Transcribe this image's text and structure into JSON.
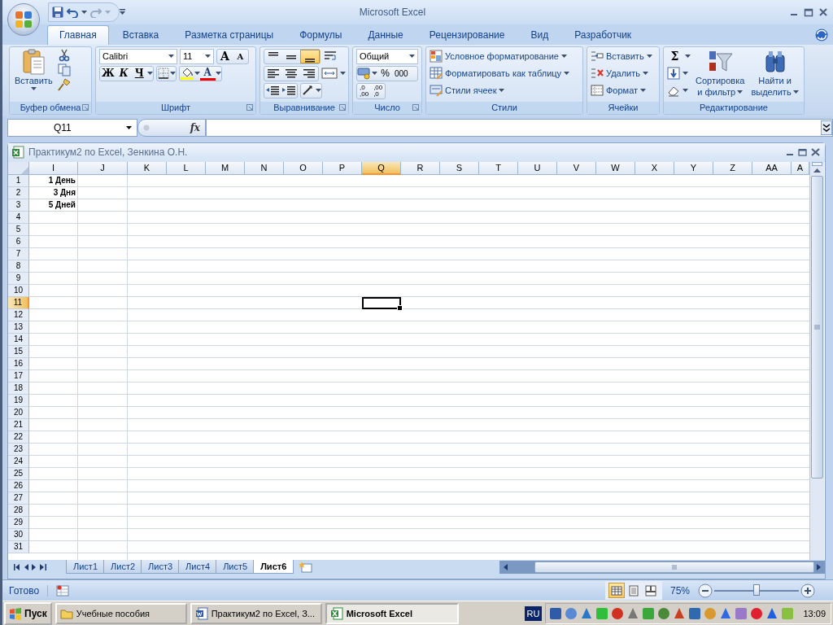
{
  "window": {
    "title": "Microsoft Excel"
  },
  "ribbon_tabs": [
    {
      "label": "Главная",
      "selected": true
    },
    {
      "label": "Вставка",
      "selected": false
    },
    {
      "label": "Разметка страницы",
      "selected": false
    },
    {
      "label": "Формулы",
      "selected": false
    },
    {
      "label": "Данные",
      "selected": false
    },
    {
      "label": "Рецензирование",
      "selected": false
    },
    {
      "label": "Вид",
      "selected": false
    },
    {
      "label": "Разработчик",
      "selected": false
    }
  ],
  "ribbon": {
    "clipboard": {
      "paste": "Вставить",
      "label": "Буфер обмена"
    },
    "font": {
      "name": "Calibri",
      "size": "11",
      "grow": "A",
      "shrink": "A",
      "bold": "Ж",
      "italic": "К",
      "underline": "Ч",
      "font_color_button": "A",
      "label": "Шрифт"
    },
    "alignment": {
      "buttons": [
        {
          "kind": "top",
          "selected": false
        },
        {
          "kind": "middle",
          "selected": false
        },
        {
          "kind": "bottom",
          "selected": true
        },
        {
          "kind": "left",
          "selected": false
        },
        {
          "kind": "center",
          "selected": false
        },
        {
          "kind": "right",
          "selected": false
        }
      ],
      "label": "Выравнивание"
    },
    "number": {
      "format": "Общий",
      "percent": "%",
      "thousands": "000",
      "decimals": [
        {
          "top": ",0",
          "bottom": ",00"
        },
        {
          "top": ",00",
          "bottom": ",0"
        }
      ],
      "label": "Число"
    },
    "styles": {
      "items": [
        "Условное форматирование",
        "Форматировать как таблицу",
        "Стили ячеек"
      ],
      "label": "Стили"
    },
    "cells": {
      "items": [
        "Вставить",
        "Удалить",
        "Формат"
      ],
      "label": "Ячейки"
    },
    "editing": {
      "sum": "Σ",
      "sort": [
        "Сортировка",
        "и фильтр"
      ],
      "find": [
        "Найти и",
        "выделить"
      ],
      "label": "Редактирование"
    }
  },
  "formula_bar": {
    "name_box": "Q11",
    "function_button": "fx"
  },
  "workbook": {
    "title": "Практикум2 по Excel, Зенкина О.Н.",
    "columns": [
      {
        "label": "I",
        "selected": false
      },
      {
        "label": "J",
        "selected": false
      },
      {
        "label": "K",
        "selected": false
      },
      {
        "label": "L",
        "selected": false
      },
      {
        "label": "M",
        "selected": false
      },
      {
        "label": "N",
        "selected": false
      },
      {
        "label": "O",
        "selected": false
      },
      {
        "label": "P",
        "selected": false
      },
      {
        "label": "Q",
        "selected": true
      },
      {
        "label": "R",
        "selected": false
      },
      {
        "label": "S",
        "selected": false
      },
      {
        "label": "T",
        "selected": false
      },
      {
        "label": "U",
        "selected": false
      },
      {
        "label": "V",
        "selected": false
      },
      {
        "label": "W",
        "selected": false
      },
      {
        "label": "X",
        "selected": false
      },
      {
        "label": "Y",
        "selected": false
      },
      {
        "label": "Z",
        "selected": false
      },
      {
        "label": "AA",
        "selected": false
      },
      {
        "label": "A",
        "selected": false
      }
    ],
    "rows": [
      {
        "label": "1",
        "selected": false,
        "cells": [
          "1 День"
        ]
      },
      {
        "label": "2",
        "selected": false,
        "cells": [
          "3 Дня"
        ]
      },
      {
        "label": "3",
        "selected": false,
        "cells": [
          "5 Дней"
        ]
      },
      {
        "label": "4",
        "selected": false
      },
      {
        "label": "5",
        "selected": false
      },
      {
        "label": "6",
        "selected": false
      },
      {
        "label": "7",
        "selected": false
      },
      {
        "label": "8",
        "selected": false
      },
      {
        "label": "9",
        "selected": false
      },
      {
        "label": "10",
        "selected": false
      },
      {
        "label": "11",
        "selected": true
      },
      {
        "label": "12",
        "selected": false
      },
      {
        "label": "13",
        "selected": false
      },
      {
        "label": "14",
        "selected": false
      },
      {
        "label": "15",
        "selected": false
      },
      {
        "label": "16",
        "selected": false
      },
      {
        "label": "17",
        "selected": false
      },
      {
        "label": "18",
        "selected": false
      },
      {
        "label": "19",
        "selected": false
      },
      {
        "label": "20",
        "selected": false
      },
      {
        "label": "21",
        "selected": false
      },
      {
        "label": "22",
        "selected": false
      },
      {
        "label": "23",
        "selected": false
      },
      {
        "label": "24",
        "selected": false
      },
      {
        "label": "25",
        "selected": false
      },
      {
        "label": "26",
        "selected": false
      },
      {
        "label": "27",
        "selected": false
      },
      {
        "label": "28",
        "selected": false
      },
      {
        "label": "29",
        "selected": false
      },
      {
        "label": "30",
        "selected": false
      },
      {
        "label": "31",
        "selected": false
      }
    ]
  },
  "sheet_tabs": [
    {
      "label": "Лист1",
      "selected": false
    },
    {
      "label": "Лист2",
      "selected": false
    },
    {
      "label": "Лист3",
      "selected": false
    },
    {
      "label": "Лист4",
      "selected": false
    },
    {
      "label": "Лист5",
      "selected": false
    },
    {
      "label": "Лист6",
      "selected": true
    }
  ],
  "status_bar": {
    "state": "Готово",
    "views": [
      {
        "kind": "normal",
        "selected": true
      },
      {
        "kind": "layout",
        "selected": false
      },
      {
        "kind": "pagebreak",
        "selected": false
      }
    ],
    "zoom": "75%",
    "zoom_slider": {
      "level": 0.5
    }
  },
  "taskbar": {
    "start": "Пуск",
    "tasks": [
      {
        "kind": "folder",
        "label": "Учебные пособия",
        "selected": false
      },
      {
        "kind": "word",
        "label": "Практикум2 по Excel, З...",
        "selected": false
      },
      {
        "kind": "excel",
        "label": "Microsoft Excel",
        "selected": true
      }
    ],
    "language": "RU",
    "clock": "13:09"
  }
}
